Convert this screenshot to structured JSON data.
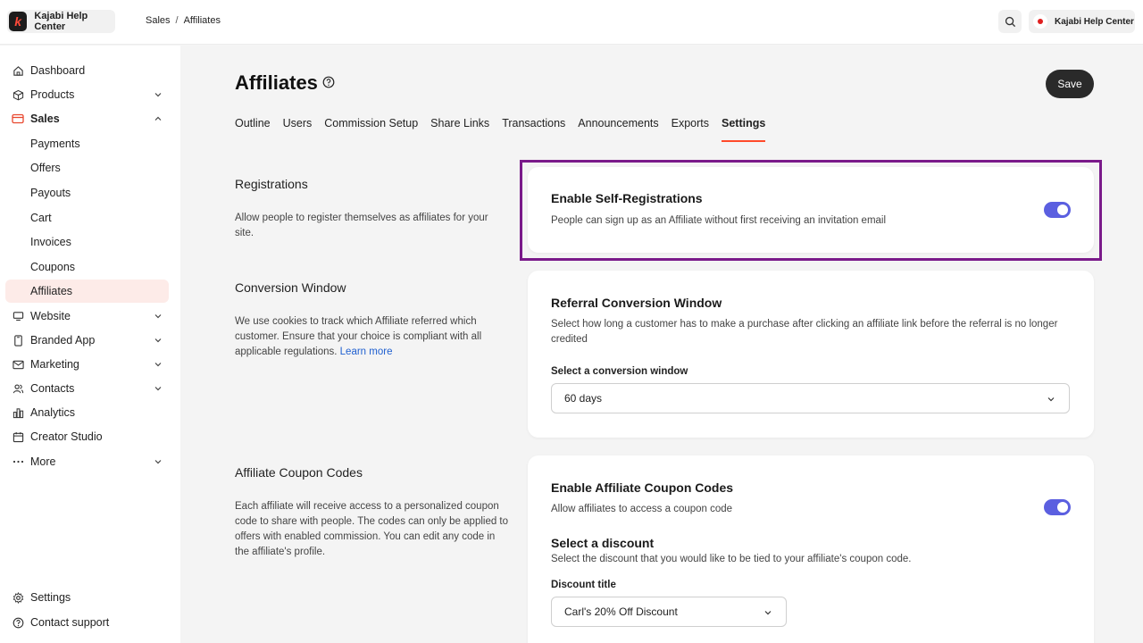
{
  "brand": {
    "name": "Kajabi Help Center",
    "logo_letter": "k"
  },
  "breadcrumb": [
    "Sales",
    "Affiliates"
  ],
  "breadcrumb_sep": "/",
  "account": {
    "name": "Kajabi Help Center"
  },
  "sidebar": {
    "items": [
      {
        "label": "Dashboard",
        "icon": "home-icon"
      },
      {
        "label": "Products",
        "icon": "box-icon",
        "chevron": "down"
      },
      {
        "label": "Sales",
        "icon": "card-icon",
        "chevron": "up",
        "expanded": true
      },
      {
        "label": "Website",
        "icon": "monitor-icon",
        "chevron": "down"
      },
      {
        "label": "Branded App",
        "icon": "phone-icon",
        "chevron": "down"
      },
      {
        "label": "Marketing",
        "icon": "mail-icon",
        "chevron": "down"
      },
      {
        "label": "Contacts",
        "icon": "people-icon",
        "chevron": "down"
      },
      {
        "label": "Analytics",
        "icon": "bar-chart-icon"
      },
      {
        "label": "Creator Studio",
        "icon": "calendar-icon"
      },
      {
        "label": "More",
        "icon": "ellipsis-icon",
        "chevron": "down"
      }
    ],
    "sales_sub": [
      "Payments",
      "Offers",
      "Payouts",
      "Cart",
      "Invoices",
      "Coupons",
      "Affiliates"
    ],
    "active_sub": "Affiliates",
    "footer": [
      {
        "label": "Settings",
        "icon": "gear-icon"
      },
      {
        "label": "Contact support",
        "icon": "help-circle-icon"
      }
    ]
  },
  "page": {
    "title": "Affiliates",
    "save_label": "Save",
    "tabs": [
      "Outline",
      "Users",
      "Commission Setup",
      "Share Links",
      "Transactions",
      "Announcements",
      "Exports",
      "Settings"
    ],
    "active_tab": "Settings"
  },
  "sections": {
    "registrations": {
      "title": "Registrations",
      "desc": "Allow people to register themselves as affiliates for your site.",
      "card_title": "Enable Self-Registrations",
      "card_desc": "People can sign up as an Affiliate without first receiving an invitation email",
      "enabled": true
    },
    "conversion": {
      "title": "Conversion Window",
      "desc": "We use cookies to track which Affiliate referred which customer. Ensure that your choice is compliant with all applicable regulations.",
      "learn_more": "Learn more",
      "card_title": "Referral Conversion Window",
      "card_desc": "Select how long a customer has to make a purchase after clicking an affiliate link before the referral is no longer credited",
      "field_label": "Select a conversion window",
      "selected": "60 days"
    },
    "coupons": {
      "title": "Affiliate Coupon Codes",
      "desc": "Each affiliate will receive access to a personalized coupon code to share with people. The codes can only be applied to offers with enabled commission. You can edit any code in the affiliate's profile.",
      "card_title": "Enable Affiliate Coupon Codes",
      "card_desc": "Allow affiliates to access a coupon code",
      "enabled": true,
      "discount_title": "Select a discount",
      "discount_desc": "Select the discount that you would like to be tied to your affiliate's coupon code.",
      "field_label": "Discount title",
      "selected": "Carl's 20% Off Discount"
    }
  },
  "colors": {
    "accent": "#ff4a2a",
    "toggle": "#5b5fe0",
    "highlight": "#7a1a8a",
    "active_bg": "#fdebe8"
  }
}
